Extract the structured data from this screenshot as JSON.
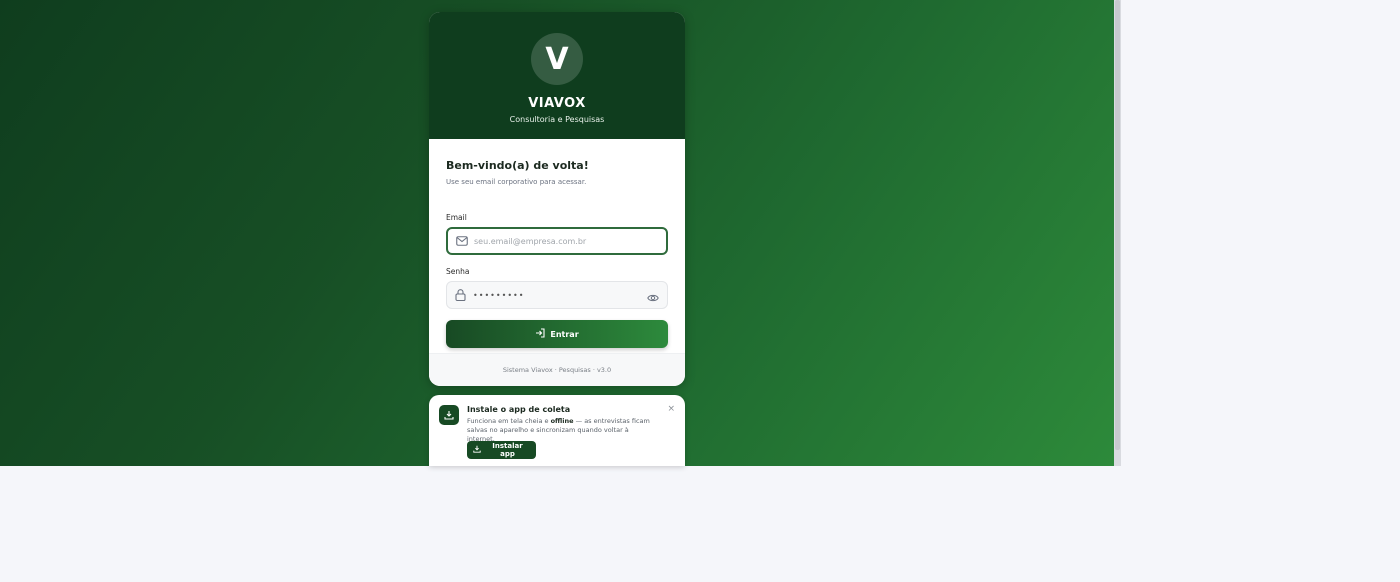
{
  "brand": {
    "name": "VIAVOX",
    "tagline": "Consultoria e Pesquisas",
    "logo_letter": "V"
  },
  "login": {
    "welcome": "Bem-vindo(a) de volta!",
    "subtitle": "Use seu email corporativo para acessar.",
    "email_label": "Email",
    "email_placeholder": "seu.email@empresa.com.br",
    "password_label": "Senha",
    "password_value": "•••••••••",
    "submit_label": "Entrar"
  },
  "footer": {
    "text": "Sistema Viavox · Pesquisas · v3.0"
  },
  "install_banner": {
    "title": "Instale o app de coleta",
    "desc_before": "Funciona em tela cheia e ",
    "desc_bold": "offline",
    "desc_after": " — as entrevistas ficam salvas no aparelho e sincronizam quando voltar à internet.",
    "button_label": "Instalar app",
    "close_symbol": "×"
  },
  "icons": [
    "mail-icon",
    "lock-icon",
    "eye-icon",
    "login-icon",
    "download-icon",
    "close-icon"
  ],
  "colors": {
    "brand_dark": "#0f3d1e",
    "brand_green": "#2d8a3c"
  }
}
